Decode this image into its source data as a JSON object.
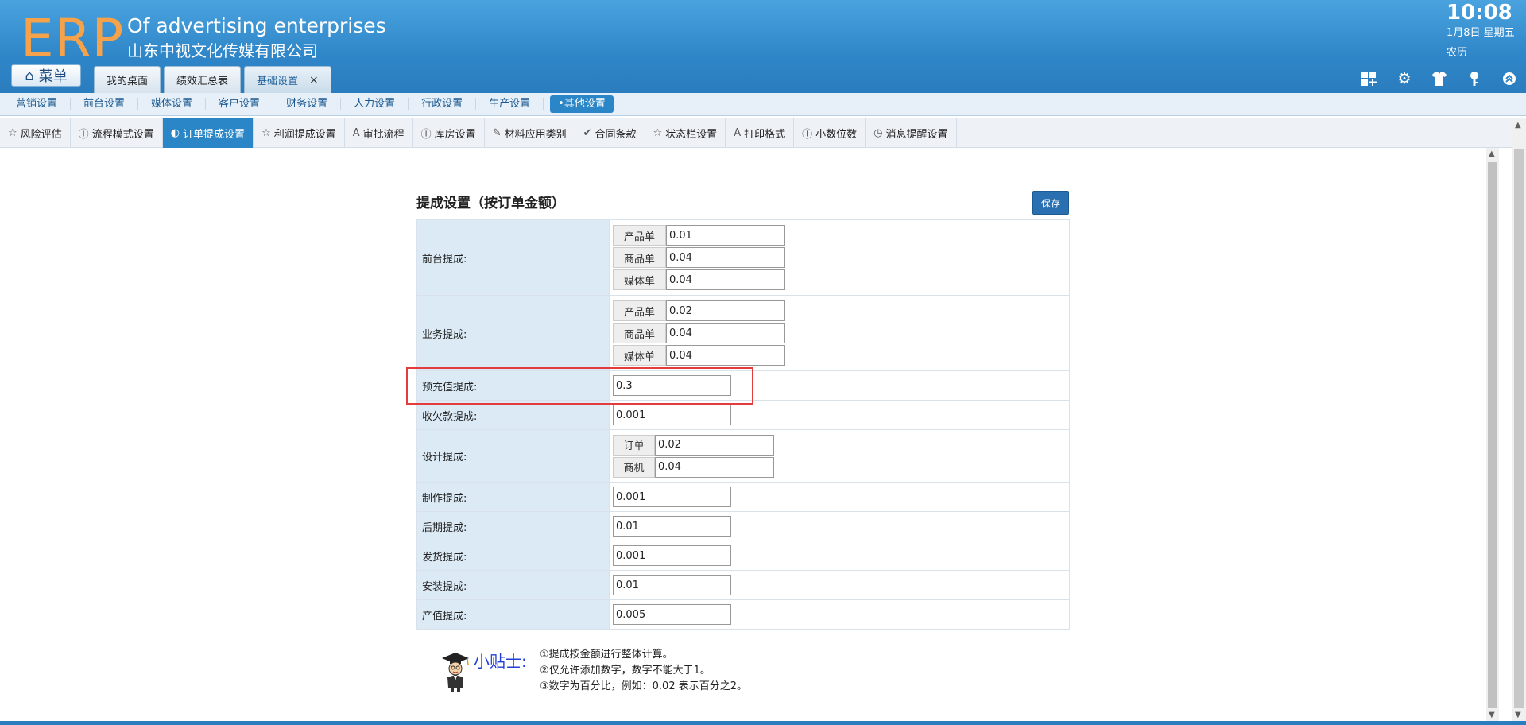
{
  "header": {
    "logo": "ERP",
    "company_en": "Of advertising enterprises",
    "company_cn": "山东中视文化传媒有限公司",
    "menu_label": "菜单",
    "tabs": [
      {
        "label": "我的桌面"
      },
      {
        "label": "绩效汇总表"
      },
      {
        "label": "基础设置",
        "active": true,
        "close": "×"
      }
    ],
    "clock": "10:08",
    "date": "1月8日 星期五",
    "lunar": "农历",
    "icons": [
      "apps-icon",
      "gear-icon",
      "shirt-icon",
      "key-icon",
      "collapse-icon"
    ]
  },
  "category_nav": {
    "items": [
      "营销设置",
      "前台设置",
      "媒体设置",
      "客户设置",
      "财务设置",
      "人力设置",
      "行政设置",
      "生产设置"
    ],
    "active": "•其他设置"
  },
  "sub_nav": {
    "items": [
      {
        "icon": "☆",
        "label": "风险评估"
      },
      {
        "icon": "Ⓘ",
        "label": "流程模式设置"
      },
      {
        "icon": "◐",
        "label": "订单提成设置",
        "active": true
      },
      {
        "icon": "☆",
        "label": "利润提成设置"
      },
      {
        "icon": "A",
        "label": "审批流程"
      },
      {
        "icon": "Ⓘ",
        "label": "库房设置"
      },
      {
        "icon": "✎",
        "label": "材料应用类别"
      },
      {
        "icon": "✔",
        "label": "合同条款"
      },
      {
        "icon": "☆",
        "label": "状态栏设置"
      },
      {
        "icon": "A",
        "label": "打印格式"
      },
      {
        "icon": "Ⓘ",
        "label": "小数位数"
      },
      {
        "icon": "◷",
        "label": "消息提醒设置"
      }
    ]
  },
  "panel": {
    "title": "提成设置（按订单金额）",
    "save_label": "保存",
    "rows": {
      "front_desk": {
        "label": "前台提成:",
        "fields": [
          {
            "prefix": "产品单",
            "value": "0.01"
          },
          {
            "prefix": "商品单",
            "value": "0.04"
          },
          {
            "prefix": "媒体单",
            "value": "0.04"
          }
        ]
      },
      "business": {
        "label": "业务提成:",
        "fields": [
          {
            "prefix": "产品单",
            "value": "0.02"
          },
          {
            "prefix": "商品单",
            "value": "0.04"
          },
          {
            "prefix": "媒体单",
            "value": "0.04"
          }
        ]
      },
      "prepaid": {
        "label": "预充值提成:",
        "value": "0.3"
      },
      "arrears": {
        "label": "收欠款提成:",
        "value": "0.001"
      },
      "design": {
        "label": "设计提成:",
        "fields": [
          {
            "prefix": "订单",
            "value": "0.02"
          },
          {
            "prefix": "商机",
            "value": "0.04"
          }
        ]
      },
      "production": {
        "label": "制作提成:",
        "value": "0.001"
      },
      "post": {
        "label": "后期提成:",
        "value": "0.01"
      },
      "shipping": {
        "label": "发货提成:",
        "value": "0.001"
      },
      "install": {
        "label": "安装提成:",
        "value": "0.01"
      },
      "output": {
        "label": "产值提成:",
        "value": "0.005"
      }
    }
  },
  "tips": {
    "title": "小贴士:",
    "lines": [
      "①提成按金额进行整体计算。",
      "②仅允许添加数字，数字不能大于1。",
      "③数字为百分比，例如：0.02 表示百分之2。"
    ]
  },
  "colors": {
    "header_blue": "#2f86c8",
    "logo_orange": "#f5a24a",
    "active_blue": "#2a86c6",
    "label_bg": "#dbeaf5",
    "highlight_red": "#e43c3c",
    "tips_blue": "#1f3fd8"
  }
}
